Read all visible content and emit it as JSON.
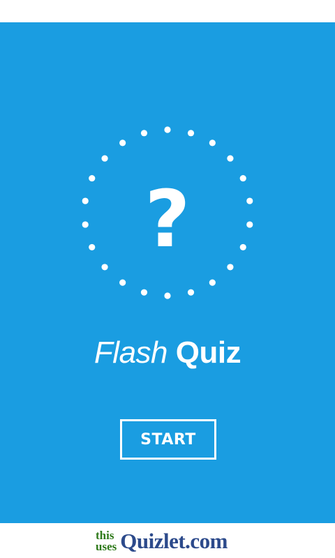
{
  "app": {
    "logo_glyph": "?",
    "title_italic": "Flash",
    "title_bold": "Quiz",
    "start_label": "START",
    "colors": {
      "panel": "#1a9de1",
      "text": "#ffffff",
      "badge_green": "#2f7a1b",
      "badge_blue": "#2c4a8b"
    }
  },
  "footer": {
    "badge_line1": "this",
    "badge_line2": "uses",
    "badge_brand": "Quizlet.com"
  }
}
